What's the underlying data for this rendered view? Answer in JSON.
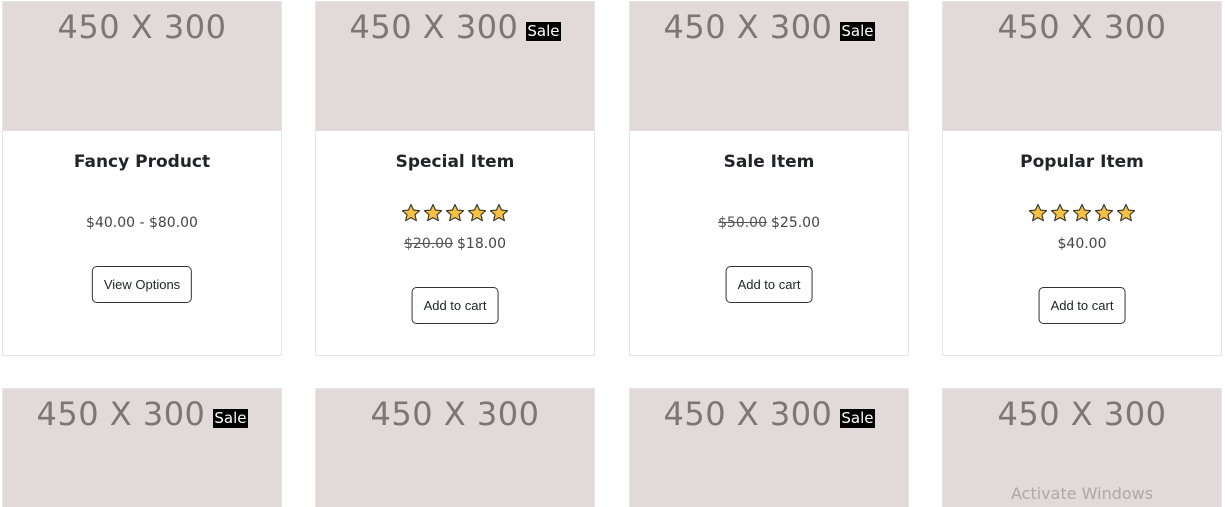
{
  "placeholder_text": "450 X 300",
  "sale_label": "Sale",
  "products_row1": [
    {
      "title": "Fancy Product",
      "sale": false,
      "rating": null,
      "price_old": "",
      "price": "$40.00 - $80.00",
      "button": "View Options"
    },
    {
      "title": "Special Item",
      "sale": true,
      "rating": 5,
      "price_old": "$20.00",
      "price": "$18.00",
      "button": "Add to cart"
    },
    {
      "title": "Sale Item",
      "sale": true,
      "rating": null,
      "price_old": "$50.00",
      "price": "$25.00",
      "button": "Add to cart"
    },
    {
      "title": "Popular Item",
      "sale": false,
      "rating": 5,
      "price_old": "",
      "price": "$40.00",
      "button": "Add to cart"
    }
  ],
  "products_row2": [
    {
      "sale": true
    },
    {
      "sale": false
    },
    {
      "sale": true
    },
    {
      "sale": false
    }
  ],
  "watermark": "Activate Windows",
  "colors": {
    "thumb_bg": "#e2d9d9",
    "thumb_text": "#7c7676",
    "sale_bg": "#000000",
    "star_fill": "#f5c242",
    "star_stroke": "#333333"
  }
}
